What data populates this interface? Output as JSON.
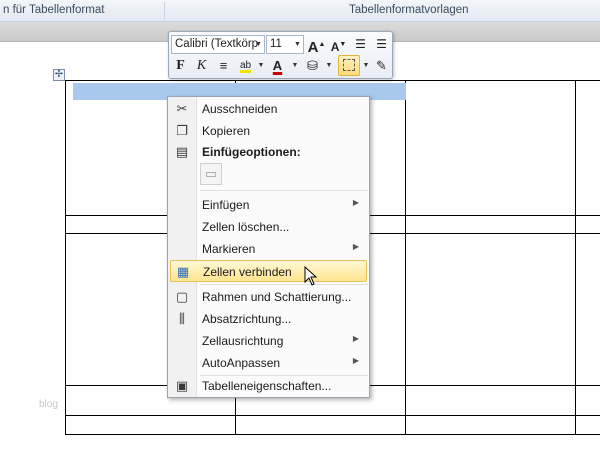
{
  "ribbon": {
    "group_left": "n für Tabellenformat",
    "group_right": "Tabellenformatvorlagen"
  },
  "mini_toolbar": {
    "font_name": "Calibri (Textkörp",
    "font_size": "11",
    "grow_font": "A",
    "shrink_font": "A",
    "bold": "F",
    "italic": "K",
    "highlight": "ab",
    "font_color": "A"
  },
  "context_menu": {
    "items": [
      {
        "label": "Ausschneiden",
        "icon": "scissors-icon"
      },
      {
        "label": "Kopieren",
        "icon": "copy-icon"
      },
      {
        "label": "Einfügeoptionen:",
        "icon": "paste-icon",
        "header": true
      },
      {
        "label": "Einfügen",
        "submenu": true
      },
      {
        "label": "Zellen löschen..."
      },
      {
        "label": "Markieren",
        "submenu": true
      },
      {
        "label": "Zellen verbinden",
        "icon": "merge-cells-icon",
        "highlighted": true
      },
      {
        "label": "Rahmen und Schattierung...",
        "icon": "borders-icon"
      },
      {
        "label": "Absatzrichtung...",
        "icon": "text-direction-icon"
      },
      {
        "label": "Zellausrichtung",
        "submenu": true
      },
      {
        "label": "AutoAnpassen",
        "submenu": true
      },
      {
        "label": "Tabelleneigenschaften...",
        "icon": "table-properties-icon"
      }
    ]
  },
  "watermark": "blog",
  "colors": {
    "selection": "#a9c8ee",
    "menu_hover": "#ffe58f",
    "ribbon_bg": "#e3e9f1"
  }
}
